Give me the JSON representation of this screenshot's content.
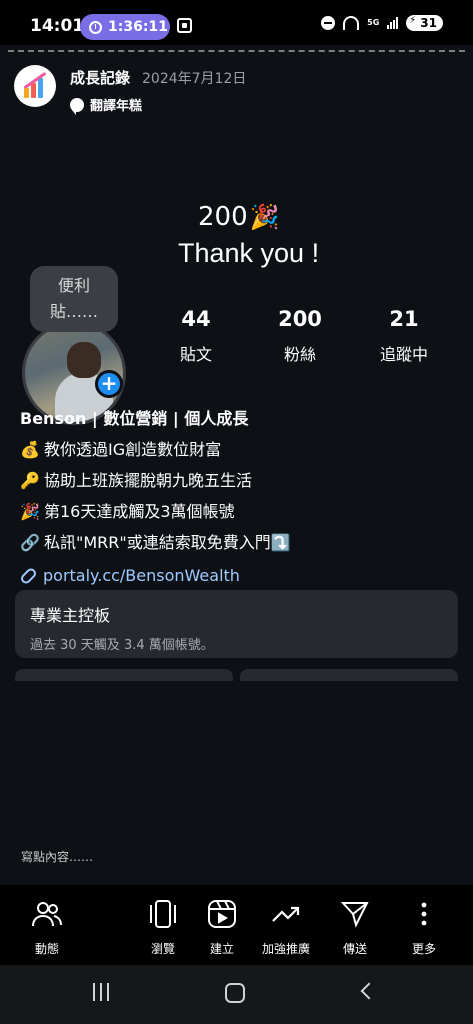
{
  "status_bar": {
    "time": "14:01",
    "timer": "1:36:11",
    "network": "5G",
    "battery": "31"
  },
  "post": {
    "author": "成長記錄",
    "date": "2024年7月12日",
    "translate_label": "翻譯年糕",
    "thanks_count": "200",
    "thanks_emoji": "🎉",
    "thanks_text": "Thank you !",
    "tooltip": [
      "便利",
      "貼……"
    ]
  },
  "profile": {
    "stats": [
      {
        "value": "44",
        "label": "貼文"
      },
      {
        "value": "200",
        "label": "粉絲"
      },
      {
        "value": "21",
        "label": "追蹤中"
      }
    ],
    "bio": [
      {
        "emoji": "",
        "text": "Benson | 數位營銷 | 個人成長"
      },
      {
        "emoji": "💰",
        "text": "教你透過IG創造數位財富"
      },
      {
        "emoji": "🔑",
        "text": "協助上班族擺脫朝九晚五生活"
      },
      {
        "emoji": "🎉",
        "text": "第16天達成觸及3萬個帳號"
      },
      {
        "emoji": "🔗",
        "text": "私訊\"MRR\"或連結索取免費入門⤵️"
      }
    ],
    "link": "portaly.cc/BensonWealth"
  },
  "dashboard": {
    "title": "專業主控板",
    "subtitle": "過去 30 天觸及 3.4 萬個帳號。"
  },
  "composer": {
    "placeholder": "寫點內容……"
  },
  "toolbar": [
    {
      "icon": "people-icon",
      "label": "動態"
    },
    {
      "icon": "browse-icon",
      "label": "瀏覽"
    },
    {
      "icon": "create-icon",
      "label": "建立"
    },
    {
      "icon": "boost-icon",
      "label": "加強推廣"
    },
    {
      "icon": "send-icon",
      "label": "傳送"
    },
    {
      "icon": "more-icon",
      "label": "更多"
    }
  ],
  "colors": {
    "accent": "#1e8cf0",
    "link": "#9ecbff",
    "timer": "#7a6ee6",
    "card": "#262930"
  }
}
